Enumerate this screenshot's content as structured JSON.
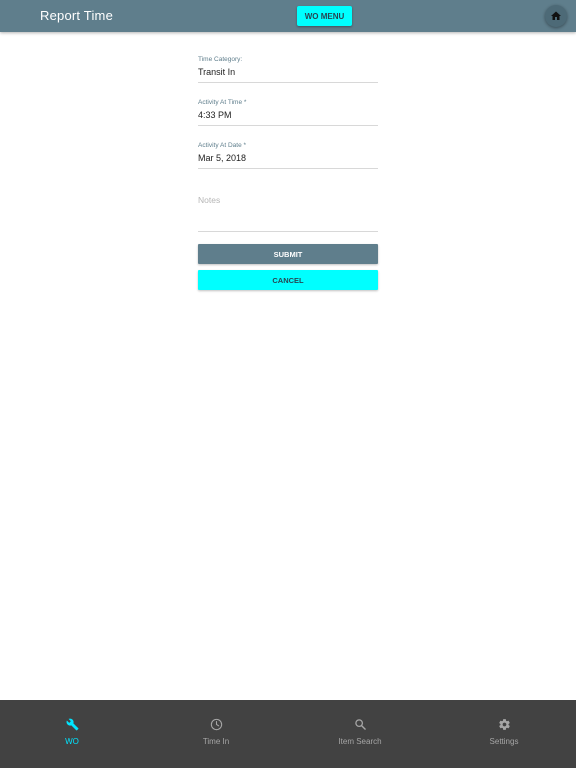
{
  "header": {
    "title": "Report Time",
    "wo_menu_label": "WO MENU",
    "home_icon": "home-icon"
  },
  "form": {
    "time_category": {
      "label": "Time Category:",
      "value": "Transit In"
    },
    "activity_time": {
      "label": "Activity At Time *",
      "value": "4:33 PM"
    },
    "activity_date": {
      "label": "Activity At Date *",
      "value": "Mar 5, 2018"
    },
    "notes": {
      "placeholder": "Notes"
    },
    "submit_label": "SUBMIT",
    "cancel_label": "CANCEL"
  },
  "bottom_nav": {
    "items": [
      {
        "label": "WO",
        "icon": "wrench-icon",
        "active": true
      },
      {
        "label": "Time In",
        "icon": "clock-icon",
        "active": false
      },
      {
        "label": "Item Search",
        "icon": "search-icon",
        "active": false
      },
      {
        "label": "Settings",
        "icon": "gear-icon",
        "active": false
      }
    ]
  },
  "colors": {
    "header_bg": "#5f7e8c",
    "accent": "#00ffff",
    "nav_bg": "#424242",
    "nav_active": "#00e5ff",
    "nav_inactive": "#a6a6a6"
  }
}
